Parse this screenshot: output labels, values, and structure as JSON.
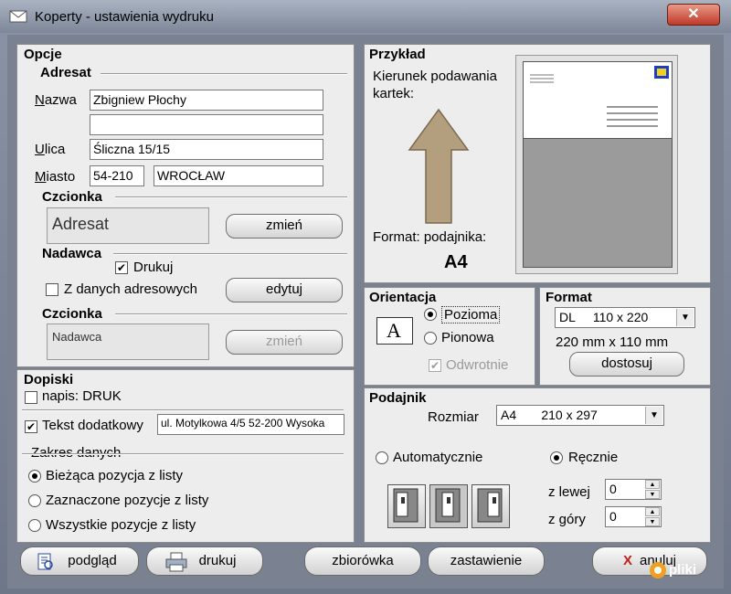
{
  "window": {
    "title": "Koperty - ustawienia wydruku",
    "close_label": "✕"
  },
  "opcje": {
    "heading": "Opcje",
    "adresat_heading": "Adresat",
    "nazwa_label": "Nazwa",
    "nazwa_value": "Zbigniew Płochy",
    "nazwa2_value": "",
    "ulica_label": "Ulica",
    "ulica_value": "Śliczna 15/15",
    "miasto_label": "Miasto",
    "kod_value": "54-210",
    "miasto_value": "WROCŁAW",
    "czcionka_heading": "Czcionka",
    "adresat_font_preview": "Adresat",
    "zmien_label": "zmień",
    "nadawca_heading": "Nadawca",
    "drukuj_label": "Drukuj",
    "drukuj_checked": "✔",
    "z_danych_label": "Z danych adresowych",
    "edytuj_label": "edytuj",
    "czcionka2_heading": "Czcionka",
    "nadawca_font_preview": "Nadawca",
    "zmien2_label": "zmień"
  },
  "dopiski": {
    "heading": "Dopiski",
    "napis_label": "napis: DRUK",
    "tekst_label": "Tekst dodatkowy",
    "tekst_checked": "✔",
    "tekst_value": "ul. Motylkowa 4/5 52-200 Wysoka",
    "zakres_heading": "Zakres danych",
    "opt1": "Bieżąca pozycja z listy",
    "opt2": "Zaznaczone pozycje z listy",
    "opt3": "Wszystkie pozycje z listy"
  },
  "przyklad": {
    "heading": "Przykład",
    "kierunek_label": "Kierunek podawania kartek:",
    "format_label": "Format: podajnika:",
    "format_value": "A4"
  },
  "orientacja": {
    "heading": "Orientacja",
    "icon_letter": "A",
    "pozioma": "Pozioma",
    "pionowa": "Pionowa",
    "odwrotnie": "Odwrotnie",
    "odwrotnie_checked": "✔"
  },
  "format": {
    "heading": "Format",
    "selected": "DL     110 x 220",
    "size_text": "220 mm x 110 mm",
    "dostosuj_label": "dostosuj"
  },
  "podajnik": {
    "heading": "Podajnik",
    "rozmiar_label": "Rozmiar",
    "rozmiar_value": "A4       210 x 297",
    "auto_label": "Automatycznie",
    "recznie_label": "Ręcznie",
    "z_lewej_label": "z lewej",
    "z_lewej_value": "0",
    "z_gory_label": "z góry",
    "z_gory_value": "0"
  },
  "bottom": {
    "podglad": "podgląd",
    "drukuj": "drukuj",
    "zbiorowka": "zbiorówka",
    "zestawienie": "zastawienie",
    "anuluj": "anuluj",
    "anuluj_icon": "X"
  },
  "watermark": "pliki"
}
